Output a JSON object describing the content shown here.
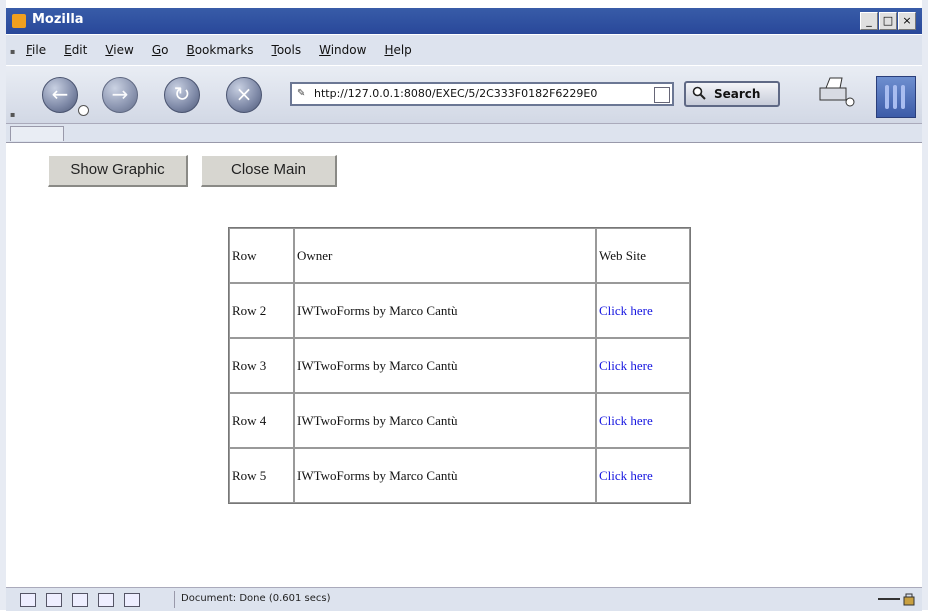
{
  "window": {
    "title": "Mozilla",
    "controls": [
      "_",
      "□",
      "×"
    ]
  },
  "menubar": {
    "items": [
      "File",
      "Edit",
      "View",
      "Go",
      "Bookmarks",
      "Tools",
      "Window",
      "Help"
    ]
  },
  "navbar": {
    "address": "http://127.0.0.1:8080/EXEC/5/2C333F0182F6229E0",
    "search_label": "Search"
  },
  "page": {
    "buttons": {
      "show_graphic": "Show Graphic",
      "close_main": "Close Main"
    },
    "table": {
      "headers": [
        "Row",
        "Owner",
        "Web Site"
      ],
      "rows": [
        {
          "row": "Row 2",
          "owner": "IWTwoForms by Marco Cantù",
          "link": "Click here"
        },
        {
          "row": "Row 3",
          "owner": "IWTwoForms by Marco Cantù",
          "link": "Click here"
        },
        {
          "row": "Row 4",
          "owner": "IWTwoForms by Marco Cantù",
          "link": "Click here"
        },
        {
          "row": "Row 5",
          "owner": "IWTwoForms by Marco Cantù",
          "link": "Click here"
        }
      ]
    }
  },
  "statusbar": {
    "text": "Document: Done (0.601 secs)"
  },
  "colors": {
    "titlebar": "#29489a",
    "link": "#1515e0",
    "chrome": "#dde3ee"
  }
}
